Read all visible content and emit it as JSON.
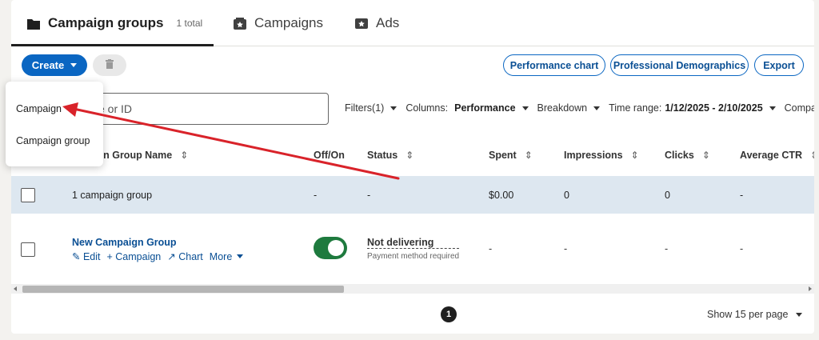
{
  "tabs": [
    {
      "label": "Campaign groups",
      "count": "1 total"
    },
    {
      "label": "Campaigns"
    },
    {
      "label": "Ads"
    }
  ],
  "toolbar": {
    "create_label": "Create",
    "performance_chart_label": "Performance chart",
    "demographics_label": "Professional Demographics",
    "export_label": "Export"
  },
  "search": {
    "visible_text": "e or ID"
  },
  "filters": {
    "filters_label": "Filters(1)",
    "columns_label": "Columns:",
    "columns_value": "Performance",
    "breakdown_label": "Breakdown",
    "time_range_label": "Time range:",
    "time_range_value": "1/12/2025 - 2/10/2025",
    "compare_label": "Compare:"
  },
  "table": {
    "headers": {
      "name": "ign Group Name",
      "off_on": "Off/On",
      "status": "Status",
      "spent": "Spent",
      "impressions": "Impressions",
      "clicks": "Clicks",
      "avg_ctr": "Average CTR"
    },
    "summary": {
      "name": "1 campaign group",
      "off_on": "-",
      "status": "-",
      "spent": "$0.00",
      "impressions": "0",
      "clicks": "0",
      "avg_ctr": "-"
    },
    "row": {
      "name": "New Campaign Group",
      "edit": "Edit",
      "campaign": "Campaign",
      "chart": "Chart",
      "more": "More",
      "status": "Not delivering",
      "status_sub": "Payment method required",
      "spent": "-",
      "impressions": "-",
      "clicks": "-",
      "avg_ctr": "-",
      "toggle_on": true
    }
  },
  "pagination": {
    "current_page": "1",
    "per_page_label": "Show 15 per page"
  },
  "menu": {
    "items": [
      "Campaign",
      "Campaign group"
    ]
  },
  "colors": {
    "primary": "#0a66c2",
    "toggle_on": "#1e7a3e",
    "summary_row": "#dde7f0",
    "annotation_arrow": "#d9232a"
  }
}
